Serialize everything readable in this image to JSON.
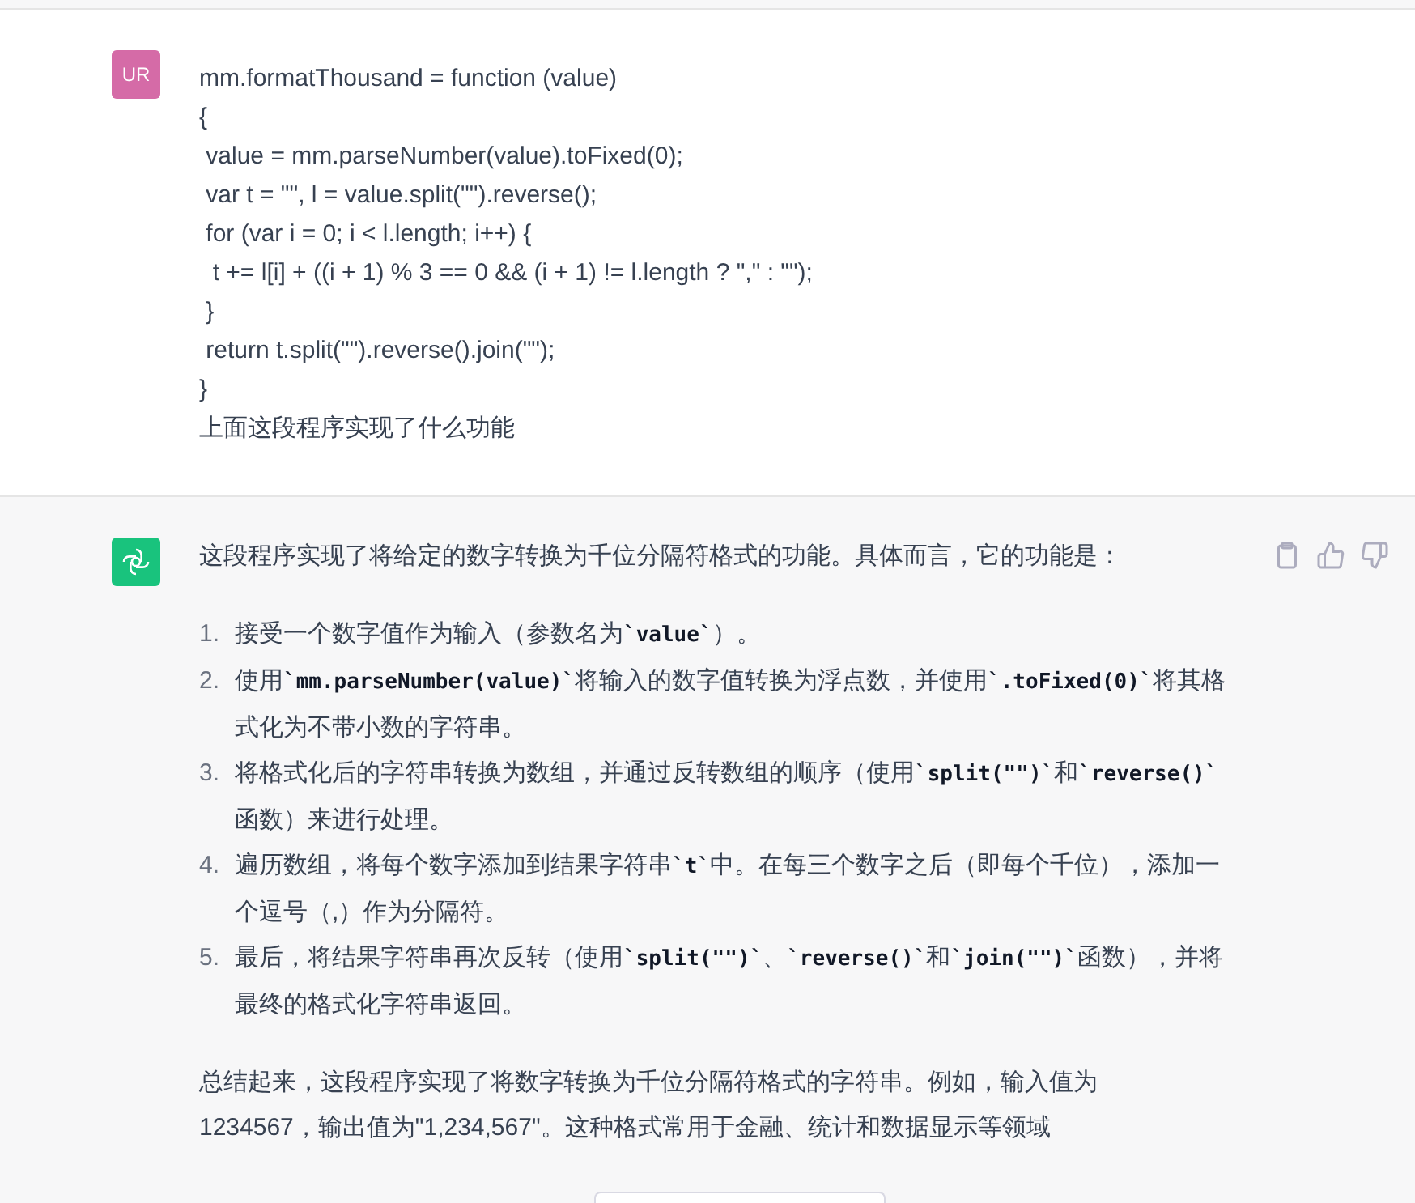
{
  "user_message": {
    "avatar": "UR",
    "code_lines": [
      "mm.formatThousand = function (value)",
      "{",
      " value = mm.parseNumber(value).toFixed(0);",
      " var t = \"\", l = value.split(\"\").reverse();",
      " for (var i = 0; i < l.length; i++) {",
      "  t += l[i] + ((i + 1) % 3 == 0 && (i + 1) != l.length ? \",\" : \"\");",
      " }",
      " return t.split(\"\").reverse().join(\"\");",
      "}"
    ],
    "question": "上面这段程序实现了什么功能"
  },
  "assistant_message": {
    "intro": "这段程序实现了将给定的数字转换为千位分隔符格式的功能。具体而言，它的功能是：",
    "steps": [
      {
        "number": "1.",
        "parts": [
          {
            "kind": "text",
            "text": "接受一个数字值作为输入（参数名为"
          },
          {
            "kind": "code",
            "text": "`value`"
          },
          {
            "kind": "text",
            "text": "）。"
          }
        ]
      },
      {
        "number": "2.",
        "parts": [
          {
            "kind": "text",
            "text": "使用"
          },
          {
            "kind": "code",
            "text": "`mm.parseNumber(value)`"
          },
          {
            "kind": "text",
            "text": "将输入的数字值转换为浮点数，并使用"
          },
          {
            "kind": "code",
            "text": "`.toFixed(0)`"
          },
          {
            "kind": "text",
            "text": "将其格式化为不带小数的字符串。"
          }
        ]
      },
      {
        "number": "3.",
        "parts": [
          {
            "kind": "text",
            "text": "将格式化后的字符串转换为数组，并通过反转数组的顺序（使用"
          },
          {
            "kind": "code",
            "text": "`split(\"\")`"
          },
          {
            "kind": "text",
            "text": "和"
          },
          {
            "kind": "code",
            "text": "`reverse()`"
          },
          {
            "kind": "text",
            "text": "函数）来进行处理。"
          }
        ]
      },
      {
        "number": "4.",
        "parts": [
          {
            "kind": "text",
            "text": "遍历数组，将每个数字添加到结果字符串"
          },
          {
            "kind": "code",
            "text": "`t`"
          },
          {
            "kind": "text",
            "text": "中。在每三个数字之后（即每个千位），添加一个逗号（,）作为分隔符。"
          }
        ]
      },
      {
        "number": "5.",
        "parts": [
          {
            "kind": "text",
            "text": "最后，将结果字符串再次反转（使用"
          },
          {
            "kind": "code",
            "text": "`split(\"\")`"
          },
          {
            "kind": "text",
            "text": "、"
          },
          {
            "kind": "code",
            "text": "`reverse()`"
          },
          {
            "kind": "text",
            "text": "和"
          },
          {
            "kind": "code",
            "text": "`join(\"\")`"
          },
          {
            "kind": "text",
            "text": "函数），并将最终的格式化字符串返回。"
          }
        ]
      }
    ],
    "summary": "总结起来，这段程序实现了将数字转换为千位分隔符格式的字符串。例如，输入值为1234567，输出值为\"1,234,567\"。这种格式常用于金融、统计和数据显示等领域"
  }
}
